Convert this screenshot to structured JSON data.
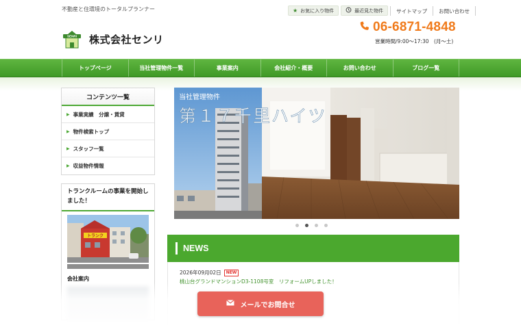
{
  "header": {
    "tagline": "不動産と住環境のトータルプランナー",
    "favorites_label": "お気に入り物件",
    "favorites_icon": "star-icon",
    "recent_label": "最近見た物件",
    "recent_icon": "history-icon",
    "sitemap_label": "サイトマップ",
    "contact_label": "お問い合わせ",
    "logo_badge_text": "SENRI",
    "company_name": "株式会社センリ",
    "phone_icon": "phone-icon",
    "phone": "06-6871-4848",
    "hours": "営業時間/9:00～17:30　(月～土)"
  },
  "nav": {
    "items": [
      {
        "label": "トップページ"
      },
      {
        "label": "当社管理物件一覧"
      },
      {
        "label": "事業案内"
      },
      {
        "label": "会社紹介・概要"
      },
      {
        "label": "お問い合わせ"
      },
      {
        "label": "ブログ一覧"
      }
    ]
  },
  "sidebar": {
    "title": "コンテンツ一覧",
    "items": [
      {
        "label": "事業実績　分譲・賃貸"
      },
      {
        "label": "物件検索トップ"
      },
      {
        "label": "スタッフ一覧"
      },
      {
        "label": "収益物件情報"
      }
    ],
    "promo": {
      "title": "トランクルームの事業を開始しました！",
      "caption": "会社案内",
      "sign_text": "トランク"
    }
  },
  "slider": {
    "caption_small": "当社管理物件",
    "caption_large": "第１７千里ハイツ",
    "dot_count": 4,
    "active_dot": 1
  },
  "news": {
    "title": "NEWS",
    "items": [
      {
        "date": "2026年09月02日",
        "badge": "NEW",
        "link": "桃山台グランドマンションD3-1108号室　リフォームUPしました！"
      }
    ]
  },
  "mail_button": {
    "label": "メールでお問合せ",
    "icon": "envelope-icon"
  },
  "colors": {
    "brand_green": "#4ba82e",
    "phone_orange": "#f07a1a",
    "mail_button": "#e8635a",
    "badge_red": "#e3312d"
  }
}
